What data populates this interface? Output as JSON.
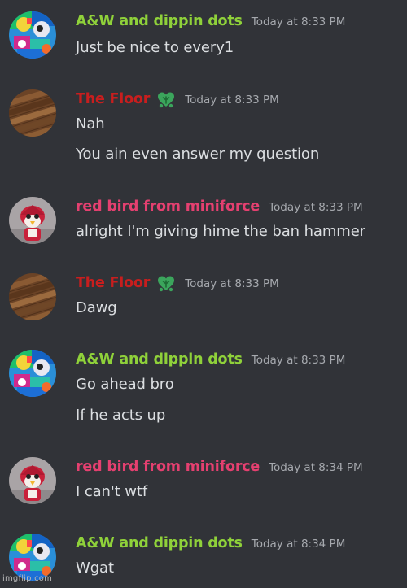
{
  "colors": {
    "background": "#313338",
    "aw_name": "#8fd13a",
    "floor_name": "#c81e1e",
    "redbird_name": "#e54070",
    "timestamp": "#a6a9ae",
    "text": "#dbdee1"
  },
  "messages": [
    {
      "author": "A&W and dippin dots",
      "avatar_icon": "colorful-collage-avatar-icon",
      "timestamp": "Today at 8:33 PM",
      "lines": [
        "Just be nice to every1"
      ]
    },
    {
      "author": "The Floor",
      "avatar_icon": "wood-floor-avatar-icon",
      "badge_icon": "green-leaf-heart-icon",
      "timestamp": "Today at 8:33 PM",
      "lines": [
        "Nah",
        "You ain even answer my question"
      ]
    },
    {
      "author": "red bird from miniforce",
      "avatar_icon": "red-bird-avatar-icon",
      "timestamp": "Today at 8:33 PM",
      "lines": [
        "alright I'm giving hime the ban hammer"
      ]
    },
    {
      "author": "The Floor",
      "avatar_icon": "wood-floor-avatar-icon",
      "badge_icon": "green-leaf-heart-icon",
      "timestamp": "Today at 8:33 PM",
      "lines": [
        "Dawg"
      ]
    },
    {
      "author": "A&W and dippin dots",
      "avatar_icon": "colorful-collage-avatar-icon",
      "timestamp": "Today at 8:33 PM",
      "lines": [
        "Go ahead bro",
        "If he acts up"
      ]
    },
    {
      "author": "red bird from miniforce",
      "avatar_icon": "red-bird-avatar-icon",
      "timestamp": "Today at 8:34 PM",
      "lines": [
        "I can't wtf"
      ]
    },
    {
      "author": "A&W and dippin dots",
      "avatar_icon": "colorful-collage-avatar-icon",
      "timestamp": "Today at 8:34 PM",
      "lines": [
        "Wgat"
      ]
    }
  ],
  "watermark": "imgflip.com"
}
